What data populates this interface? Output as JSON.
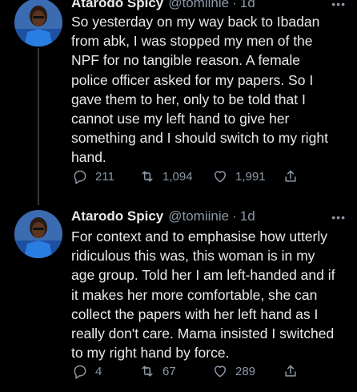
{
  "tweets": [
    {
      "name": "Atarodo Spicy",
      "handle": "@tomiinie",
      "time": "1d",
      "text": "So yesterday on my way back to Ibadan from abk, I was stopped my men of the NPF for no tangible reason. A female police officer asked for my papers. So I gave them to her, only to be told that I cannot use my left hand to give her something and I should switch to my right hand.",
      "replies": "211",
      "retweets": "1,094",
      "likes": "1,991"
    },
    {
      "name": "Atarodo Spicy",
      "handle": "@tomiinie",
      "time": "1d",
      "text": "For context and to emphasise how utterly ridiculous this was, this woman is in my age group. Told her I  am left-handed and if it makes her more comfortable, she can collect the papers with her left hand as I really don't care. Mama insisted I switched to my right hand by force.",
      "replies": "4",
      "retweets": "67",
      "likes": "289"
    }
  ],
  "separator": "·",
  "more_glyph": "•••",
  "colors": {
    "background": "#000000",
    "text": "#e7e9ea",
    "muted": "#8b98a5",
    "thread": "#333639"
  }
}
